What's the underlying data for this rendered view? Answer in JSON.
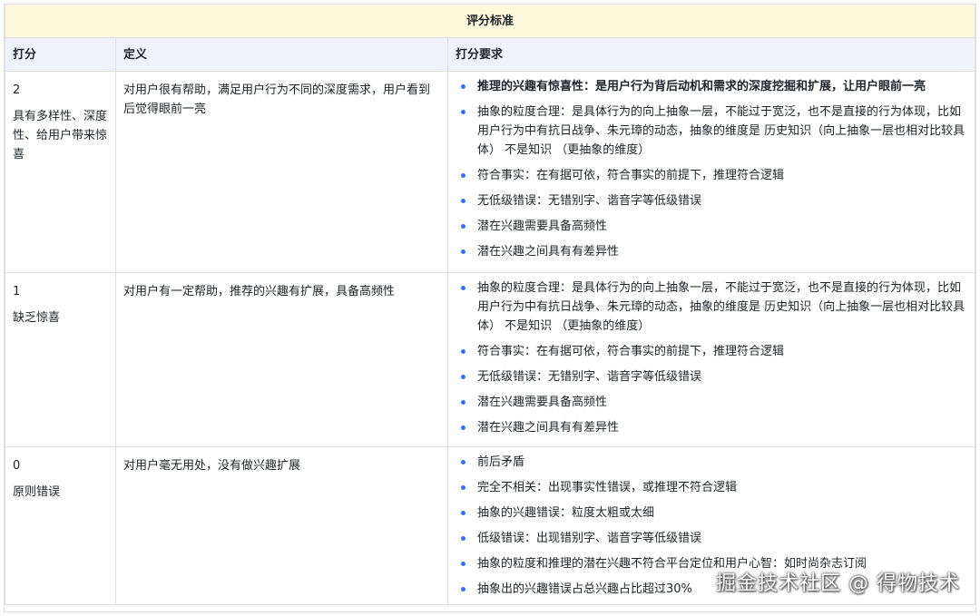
{
  "table": {
    "title": "评分标准",
    "headers": {
      "score": "打分",
      "definition": "定义",
      "requirement": "打分要求"
    },
    "rows": [
      {
        "score": "2",
        "label": "具有多样性、深度性、给用户带来惊喜",
        "definition": "对用户很有帮助，满足用户行为不同的深度需求，用户看到后觉得眼前一亮",
        "requirements": [
          "推理的兴趣有惊喜性：是用户行为背后动机和需求的深度挖掘和扩展，让用户眼前一亮",
          "抽象的粒度合理：是具体行为的向上抽象一层，不能过于宽泛，也不是直接的行为体现，比如用户行为中有抗日战争、朱元璋的动态，抽象的维度是 历史知识（向上抽象一层也相对比较具体） 不是知识 （更抽象的维度）",
          "符合事实：在有据可依，符合事实的前提下，推理符合逻辑",
          "无低级错误：无错别字、谐音字等低级错误",
          "潜在兴趣需要具备高频性",
          "潜在兴趣之间具有有差异性"
        ]
      },
      {
        "score": "1",
        "label": "缺乏惊喜",
        "definition": "对用户有一定帮助，推荐的兴趣有扩展，具备高频性",
        "requirements": [
          "抽象的粒度合理：是具体行为的向上抽象一层，不能过于宽泛，也不是直接的行为体现，比如用户行为中有抗日战争、朱元璋的动态，抽象的维度是 历史知识（向上抽象一层也相对比较具体） 不是知识 （更抽象的维度）",
          "符合事实：在有据可依，符合事实的前提下，推理符合逻辑",
          "无低级错误：无错别字、谐音字等低级错误",
          "潜在兴趣需要具备高频性",
          "潜在兴趣之间具有有差异性"
        ]
      },
      {
        "score": "0",
        "label": "原则错误",
        "definition": "对用户毫无用处，没有做兴趣扩展",
        "requirements": [
          "前后矛盾",
          "完全不相关：出现事实性错误，或推理不符合逻辑",
          "抽象的兴趣错误：粒度太粗或太细",
          "低级错误：出现错别字、谐音字等低级错误",
          "抽象的粒度和推理的潜在兴趣不符合平台定位和用户心智：如时尚杂志订阅",
          "抽象出的兴趣错误占总兴趣占比超过30%"
        ]
      }
    ]
  },
  "watermark": "掘金技术社区 @ 得物技术",
  "colors": {
    "bullet": "#3370ff",
    "title_bg": "#fdf8dc",
    "header_bg": "#eff2fd",
    "border": "#dee0e3"
  }
}
